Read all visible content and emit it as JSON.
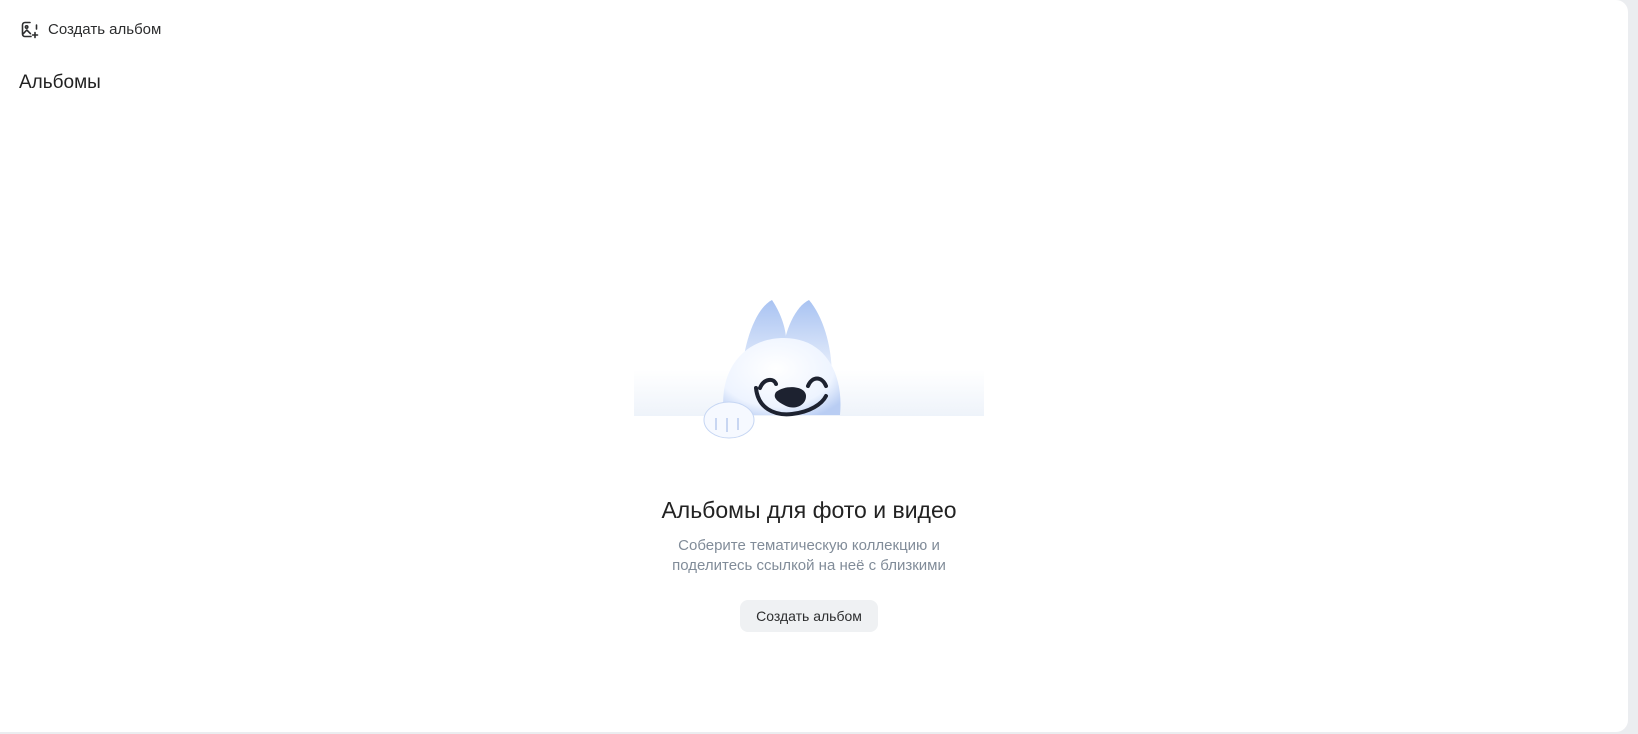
{
  "toolbar": {
    "create_album_label": "Создать альбом",
    "create_album_icon": "image-plus-icon"
  },
  "page": {
    "title": "Альбомы"
  },
  "empty_state": {
    "illustration": "smiling-white-fox-mascot",
    "title": "Альбомы для фото и видео",
    "description": "Соберите тематическую коллекцию и поделитесь ссылкой на неё с близкими",
    "button_label": "Создать альбом"
  },
  "colors": {
    "background": "#ebedf0",
    "panel": "#ffffff",
    "text_primary": "#222222",
    "text_secondary": "#818c99",
    "button_bg": "#eff1f3"
  }
}
